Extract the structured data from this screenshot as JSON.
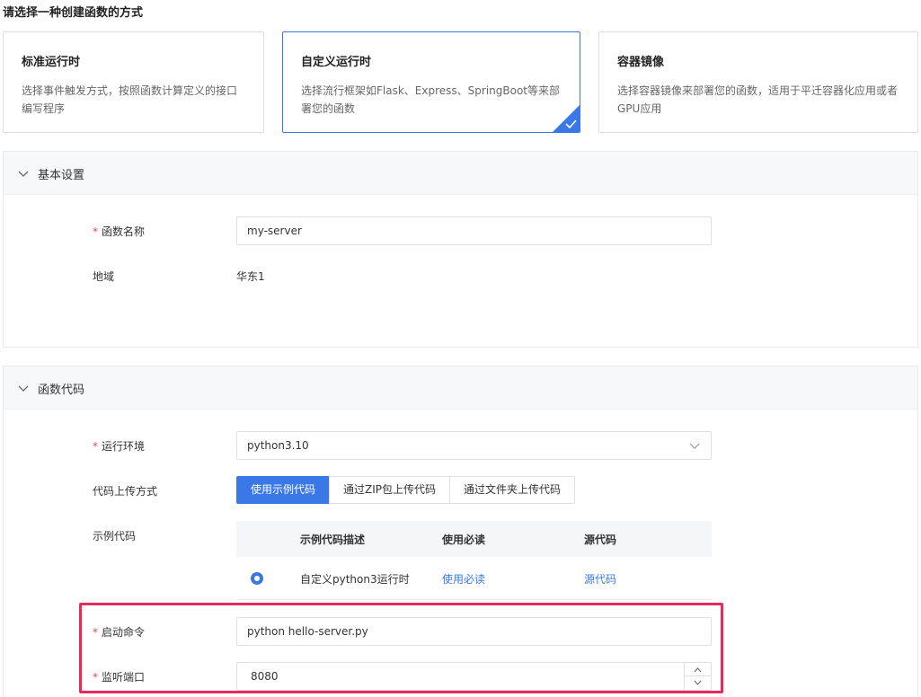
{
  "page": {
    "title": "请选择一种创建函数的方式"
  },
  "methods": [
    {
      "title": "标准运行时",
      "desc": "选择事件触发方式，按照函数计算定义的接口编写程序"
    },
    {
      "title": "自定义运行时",
      "desc": "选择流行框架如Flask、Express、SpringBoot等来部署您的函数"
    },
    {
      "title": "容器镜像",
      "desc": "选择容器镜像来部署您的函数，适用于平迁容器化应用或者GPU应用"
    }
  ],
  "selected_method_index": 1,
  "basic": {
    "title": "基本设置",
    "name_label": "函数名称",
    "name_value": "my-server",
    "region_label": "地域",
    "region_value": "华东1"
  },
  "code": {
    "title": "函数代码",
    "runtime_label": "运行环境",
    "runtime_value": "python3.10",
    "upload_label": "代码上传方式",
    "upload_options": [
      "使用示例代码",
      "通过ZIP包上传代码",
      "通过文件夹上传代码"
    ],
    "sample_label": "示例代码",
    "table_headers": [
      "示例代码描述",
      "使用必读",
      "源代码"
    ],
    "table_row": {
      "desc": "自定义python3运行时",
      "readme": "使用必读",
      "source": "源代码"
    },
    "start_cmd_label": "启动命令",
    "start_cmd_value": "python hello-server.py",
    "port_label": "监听端口",
    "port_value": "8080"
  },
  "colors": {
    "accent": "#3b78e7",
    "required": "#e5484d",
    "highlight": "#e8295a"
  }
}
